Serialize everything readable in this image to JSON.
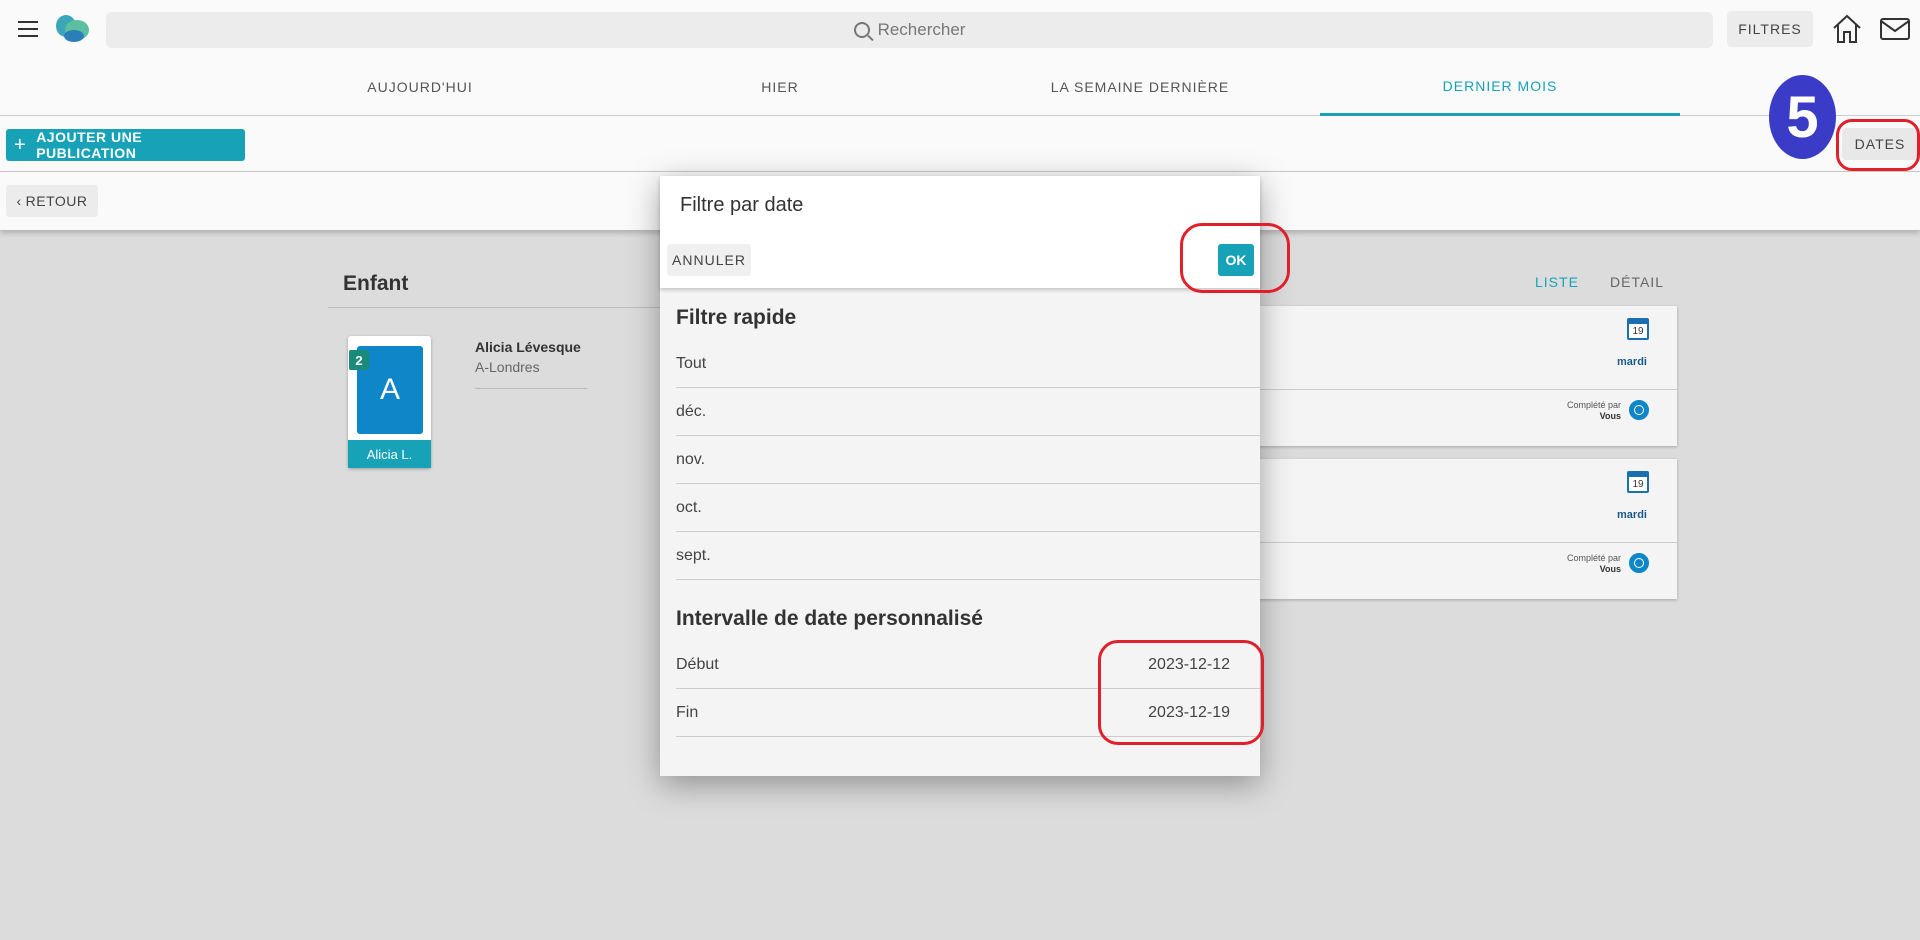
{
  "topbar": {
    "search_placeholder": "Rechercher",
    "filters_label": "FILTRES"
  },
  "tabs": [
    {
      "label": "AUJOURD'HUI"
    },
    {
      "label": "HIER"
    },
    {
      "label": "LA SEMAINE DERNIÈRE"
    },
    {
      "label": "DERNIER MOIS",
      "active": true
    }
  ],
  "actions": {
    "add_label": "AJOUTER UNE PUBLICATION",
    "dates_label": "DATES",
    "back_label": "RETOUR"
  },
  "step_badge": "5",
  "section": {
    "title": "Enfant",
    "view_list": "LISTE",
    "view_detail": "DÉTAIL"
  },
  "child": {
    "avatar_letter": "A",
    "count": "2",
    "short_name": "Alicia L.",
    "full_name": "Alicia Lévesque",
    "location": "A-Londres"
  },
  "publications": [
    {
      "calendar_day": "19",
      "weekday": "mardi",
      "completed_by_label": "Complété par",
      "completed_by": "Vous"
    },
    {
      "calendar_day": "19",
      "weekday": "mardi",
      "completed_by_label": "Complété par",
      "completed_by": "Vous"
    }
  ],
  "dialog": {
    "title": "Filtre par date",
    "cancel_label": "ANNULER",
    "ok_label": "OK",
    "quick_title": "Filtre rapide",
    "quick_items": [
      "Tout",
      "déc.",
      "nov.",
      "oct.",
      "sept."
    ],
    "range_title": "Intervalle de date personnalisé",
    "start_label": "Début",
    "start_value": "2023-12-12",
    "end_label": "Fin",
    "end_value": "2023-12-19"
  },
  "colors": {
    "accent": "#17a2b8",
    "annotation": "#e0202a",
    "badge": "#3a3cc8"
  }
}
